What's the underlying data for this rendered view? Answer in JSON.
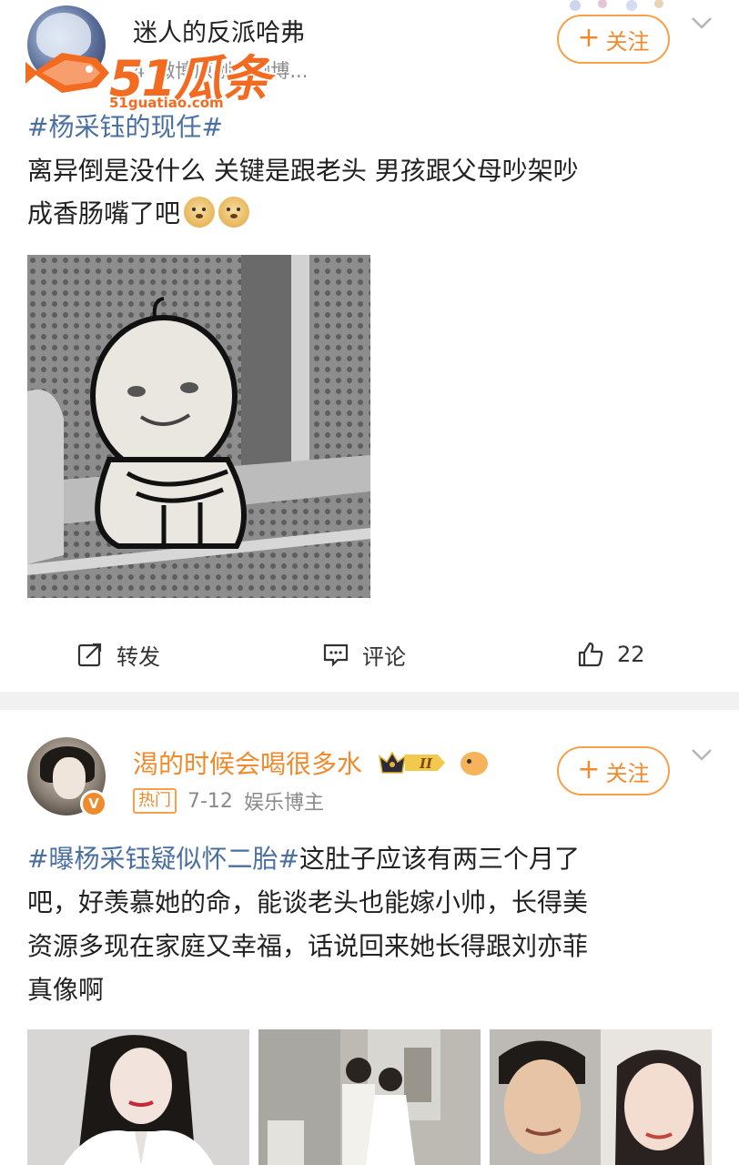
{
  "post1": {
    "username": "迷人的反派哈弗",
    "time": "4",
    "source": "微博原创视频博...",
    "follow_label": "关注",
    "hashtag": "#杨采钰的现任#",
    "text_line1": "离异倒是没什么  关键是跟老头    男孩跟父母吵架吵",
    "text_line2": "成香肠嘴了吧",
    "emoji": "doge-emoji",
    "image_icon": "meme-sitting-figure"
  },
  "watermark": {
    "big": "51瓜条",
    "url": "51guatiao.com"
  },
  "actions": {
    "repost_label": "转发",
    "comment_label": "评论",
    "like_count": "22"
  },
  "post2": {
    "username": "渴的时候会喝很多水",
    "level_badge": "II",
    "hot_badge": "热门",
    "date": "7-12",
    "category": "娱乐博主",
    "follow_label": "关注",
    "hashtag": "#曝杨采钰疑似怀二胎#",
    "text_part1": "这肚子应该有两三个月了",
    "text_line2": "吧，好羡慕她的命，能谈老头也能嫁小帅，长得美",
    "text_line3": "资源多现在家庭又幸福，话说回来她长得跟刘亦菲",
    "text_line4": "真像啊",
    "verified_badge": "V"
  },
  "colors": {
    "accent_orange": "#f08a2b",
    "link_blue": "#4a6fa1",
    "separator": "#f1f1f1"
  }
}
